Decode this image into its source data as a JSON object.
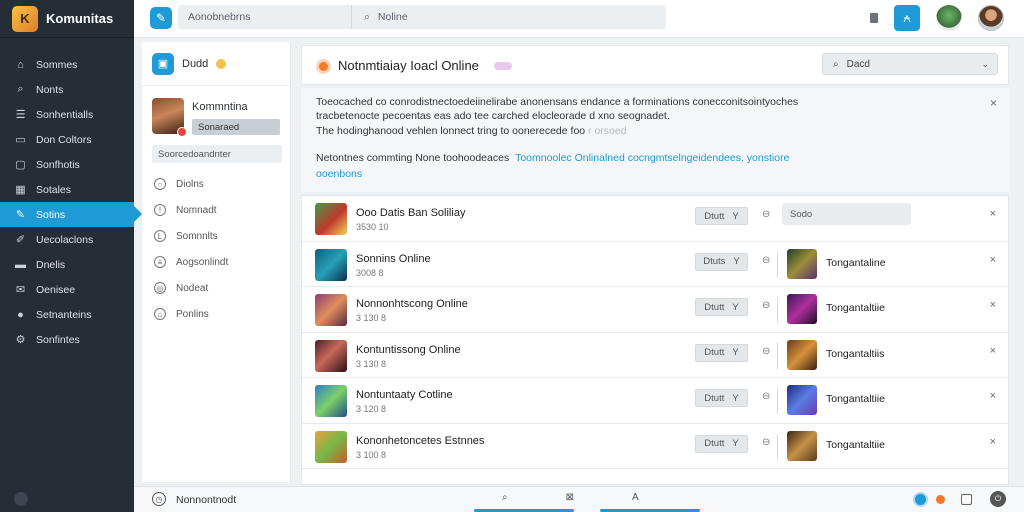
{
  "brand": {
    "name": "Komunitas"
  },
  "sidebar": {
    "items": [
      {
        "label": "Sommes",
        "icon": "home-icon",
        "glyph": "⌂"
      },
      {
        "label": "Nonts",
        "icon": "search-icon",
        "glyph": "⌕"
      },
      {
        "label": "Sonhentialls",
        "icon": "list-icon",
        "glyph": "☰"
      },
      {
        "label": "Don Coltors",
        "icon": "monitor-icon",
        "glyph": "▭"
      },
      {
        "label": "Sonfhotis",
        "icon": "chat-icon",
        "glyph": "▢"
      },
      {
        "label": "Sotales",
        "icon": "grid-icon",
        "glyph": "▦"
      },
      {
        "label": "Sotins",
        "icon": "pencil-icon",
        "glyph": "✎"
      },
      {
        "label": "Uecolaclons",
        "icon": "edit-icon",
        "glyph": "✐"
      },
      {
        "label": "Dnelis",
        "icon": "folder-icon",
        "glyph": "▬"
      },
      {
        "label": "Oenisee",
        "icon": "mail-icon",
        "glyph": "✉"
      },
      {
        "label": "Setnanteins",
        "icon": "user-icon",
        "glyph": "●"
      },
      {
        "label": "Sonfintes",
        "icon": "settings-icon",
        "glyph": "⚙"
      }
    ],
    "active_index": 6
  },
  "topbar": {
    "search_left": "Aonobnebrns",
    "search_right": "Noline",
    "share_glyph": "⍲",
    "compose_glyph": "✎"
  },
  "col2": {
    "title": "Dudd",
    "cube_glyph": "▣",
    "profile_name": "Kommntina",
    "profile_tag": "Sonaraed",
    "field": "Soorcedoandnter",
    "items": [
      {
        "label": "Diolns",
        "glyph": "○"
      },
      {
        "label": "Nomnadt",
        "glyph": "!"
      },
      {
        "label": "Somnnlts",
        "glyph": "L"
      },
      {
        "label": "Aogsonlindt",
        "glyph": "≡"
      },
      {
        "label": "Nodeat",
        "glyph": "◎"
      },
      {
        "label": "Ponlins",
        "glyph": "⌂"
      }
    ]
  },
  "main": {
    "title": "Notnmtiaiay Ioacl Online",
    "select_value": "Dacd",
    "search_glyph": "⌕",
    "chevron_glyph": "⌄",
    "close_glyph": "×"
  },
  "notice": {
    "line1": "Toeocached co conrodistnectoedeiinelirabe anonensans endance a forminations conecconitsointyoches",
    "line2": "tracbetenocte pecoentas eas ado tee carched elocleorade d xno seognadet.",
    "line3": "The hodinghanood vehlen lonnect tring to oonerecede foo",
    "line3_faded": "r orsoed",
    "line4_text": "Netontnes commting None toohoodeaces",
    "line4_link": "Toomnoolec Onlinalned cocngmtselngeidendees. yonstiore",
    "line5_link": "ooenbons"
  },
  "rows": [
    {
      "title": "Ooo Datis Ban Soliliay",
      "sub": "3530 10",
      "btn": "Dtutt",
      "btn_caret": "Y",
      "field": "Sodo",
      "label2": ""
    },
    {
      "title": "Sonnins Online",
      "sub": "3008 8",
      "btn": "Dtuts",
      "btn_caret": "Y",
      "field": "",
      "label2": "Tongantaline"
    },
    {
      "title": "Nonnonhtscong Online",
      "sub": "3 130 8",
      "btn": "Dtutt",
      "btn_caret": "Y",
      "field": "",
      "label2": "Tongantaltiie"
    },
    {
      "title": "Kontuntissong Online",
      "sub": "3 130 8",
      "btn": "Dtutt",
      "btn_caret": "Y",
      "field": "",
      "label2": "Tongantaltiis"
    },
    {
      "title": "Nontuntaaty Cotline",
      "sub": "3 120 8",
      "btn": "Dtutt",
      "btn_caret": "Y",
      "field": "",
      "label2": "Tongantaltiie"
    },
    {
      "title": "Kononhetoncetes Estnnes",
      "sub": "3 100 8",
      "btn": "Dtutt",
      "btn_caret": "Y",
      "field": "",
      "label2": "Tongantaltiie"
    }
  ],
  "bottombar": {
    "label": "Nonnontnodt",
    "mid": [
      "⌕",
      "⊠",
      "A"
    ]
  }
}
